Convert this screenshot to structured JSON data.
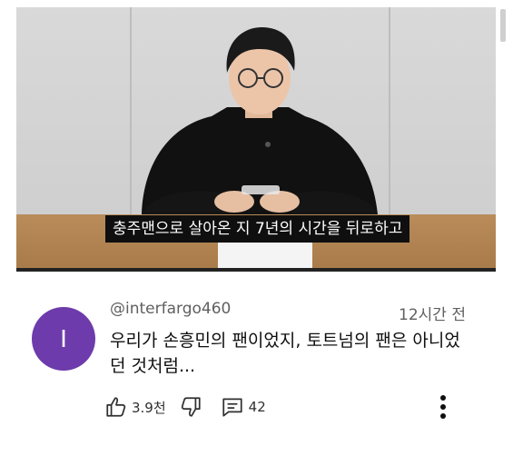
{
  "video": {
    "caption": "충주맨으로 살아온 지 7년의 시간을 뒤로하고"
  },
  "comment": {
    "avatar_letter": "I",
    "avatar_color": "#6d3bab",
    "username": "@interfargo460",
    "time": "12시간 전",
    "text": "우리가 손흥민의 팬이었지, 토트넘의 팬은 아니었던 것처럼...",
    "likes": "3.9천",
    "replies": "42"
  },
  "icons": {
    "like": "thumbs-up-icon",
    "dislike": "thumbs-down-icon",
    "reply": "comment-icon",
    "more": "more-vertical-icon"
  }
}
